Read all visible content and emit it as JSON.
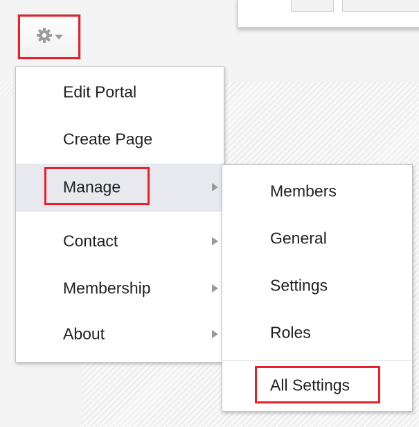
{
  "toolbar": {
    "settings_icon": "gear-icon",
    "dropdown_icon": "chevron-down-icon"
  },
  "main_menu": {
    "items": [
      {
        "label": "Edit Portal",
        "has_submenu": false
      },
      {
        "label": "Create Page",
        "has_submenu": false
      },
      {
        "label": "Manage",
        "has_submenu": true,
        "active": true,
        "highlighted": true
      },
      {
        "label": "Contact",
        "has_submenu": true
      },
      {
        "label": "Membership",
        "has_submenu": true
      },
      {
        "label": "About",
        "has_submenu": true
      }
    ]
  },
  "manage_submenu": {
    "items": [
      {
        "label": "Members"
      },
      {
        "label": "General"
      },
      {
        "label": "Settings"
      },
      {
        "label": "Roles"
      },
      {
        "label": "All Settings",
        "highlighted": true
      }
    ]
  },
  "colors": {
    "highlight": "#e8202a",
    "active_row": "#e7e9ef",
    "menu_bg": "#ffffff"
  }
}
